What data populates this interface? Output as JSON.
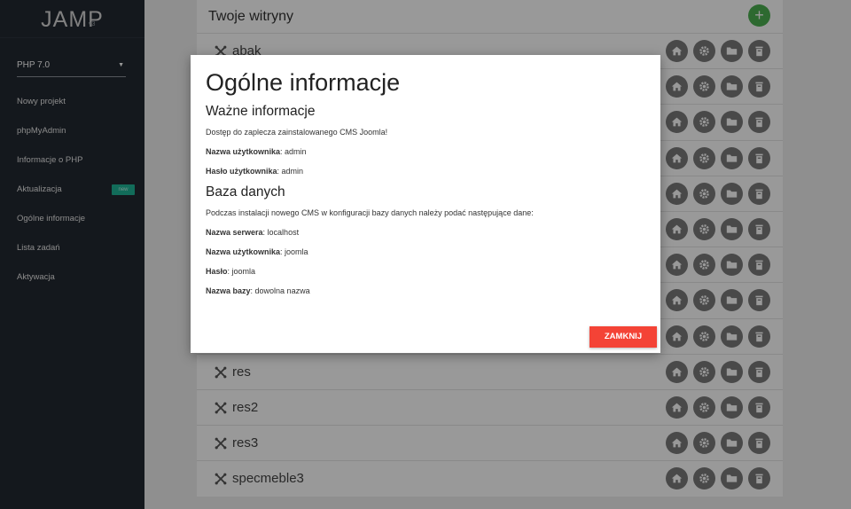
{
  "sidebar": {
    "logo": "JAMP",
    "version": "v3",
    "php_version": "PHP 7.0",
    "items": [
      {
        "label": "Nowy projekt"
      },
      {
        "label": "phpMyAdmin"
      },
      {
        "label": "Informacje o PHP"
      },
      {
        "label": "Aktualizacja",
        "badge": "new"
      },
      {
        "label": "Ogólne informacje"
      },
      {
        "label": "Lista zadań"
      },
      {
        "label": "Aktywacja"
      }
    ]
  },
  "main": {
    "title": "Twoje witryny",
    "add_label": "+",
    "sites": [
      "abak",
      "",
      "",
      "",
      "",
      "",
      "",
      "",
      "",
      "res",
      "res2",
      "res3",
      "specmeble3"
    ]
  },
  "modal": {
    "title": "Ogólne informacje",
    "section1": "Ważne informacje",
    "intro": "Dostęp do zaplecza zainstalowanego CMS Joomla!",
    "user_label": "Nazwa użytkownika",
    "user_value": ": admin",
    "pass_label": "Hasło użytkownika",
    "pass_value": ": admin",
    "section2": "Baza danych",
    "db_intro": "Podczas instalacji nowego CMS w konfiguracji bazy danych należy podać następujące dane:",
    "server_label": "Nazwa serwera",
    "server_value": ": localhost",
    "db_user_label": "Nazwa użytkownika",
    "db_user_value": ": joomla",
    "db_pass_label": "Hasło",
    "db_pass_value": ": joomla",
    "db_name_label": "Nazwa bazy",
    "db_name_value": ": dowolna nazwa",
    "close_label": "ZAMKNIJ"
  }
}
